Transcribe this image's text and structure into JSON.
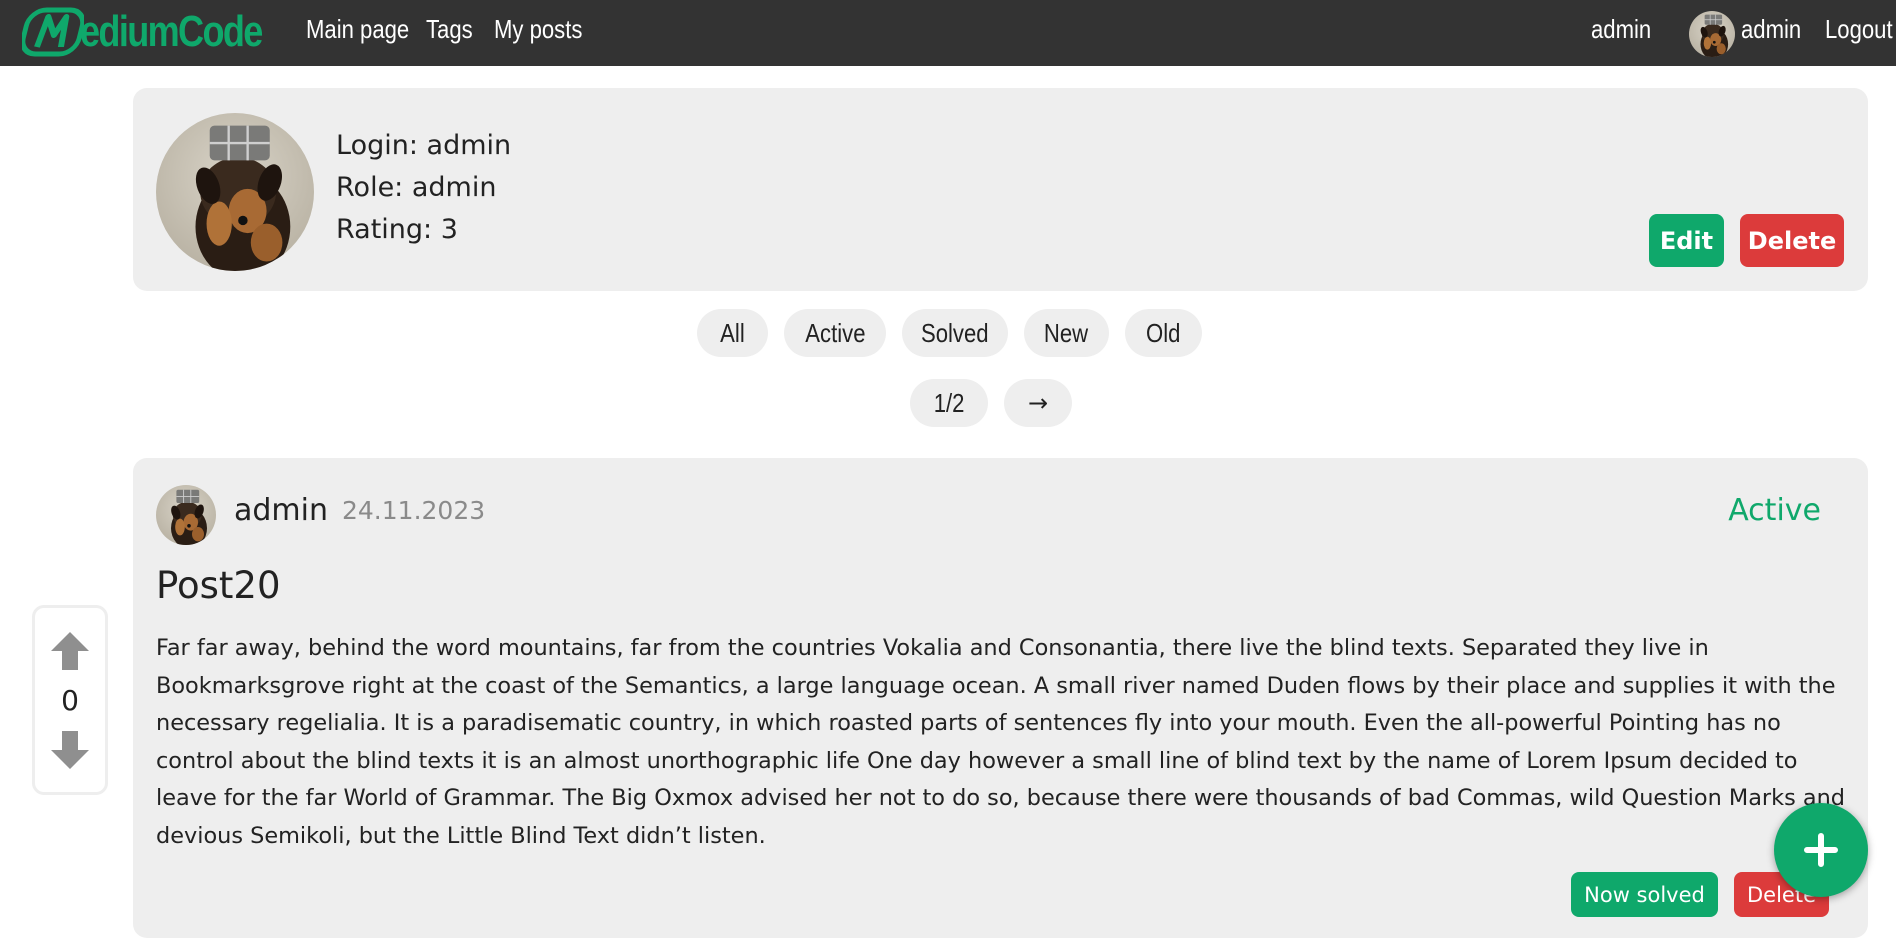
{
  "navbar": {
    "logo_text": "ediumCode",
    "links": [
      "Main page",
      "Tags",
      "My posts"
    ],
    "role_label": "admin",
    "user_name": "admin",
    "logout_label": "Logout"
  },
  "profile": {
    "login_line": "Login: admin",
    "role_line": "Role: admin",
    "rating_line": "Rating: 3",
    "edit_label": "Edit",
    "delete_label": "Delete"
  },
  "filters": [
    "All",
    "Active",
    "Solved",
    "New",
    "Old"
  ],
  "pagination": {
    "page": "1/2",
    "next": "→"
  },
  "post": {
    "author": "admin",
    "date": "24.11.2023",
    "status": "Active",
    "title": "Post20",
    "body": "Far far away, behind the word mountains, far from the countries Vokalia and Consonantia, there live the blind texts. Separated they live in Bookmarksgrove right at the coast of the Semantics, a large language ocean. A small river named Duden flows by their place and supplies it with the necessary regelialia. It is a paradisematic country, in which roasted parts of sentences fly into your mouth. Even the all-powerful Pointing has no control about the blind texts it is an almost unorthographic life One day however a small line of blind text by the name of Lorem Ipsum decided to leave for the far World of Grammar. The Big Oxmox advised her not to do so, because there were thousands of bad Commas, wild Question Marks and devious Semikoli, but the Little Blind Text didn’t listen.",
    "solve_label": "Now solved",
    "delete_label": "Delete"
  },
  "vote": {
    "count": "0"
  },
  "fab": {
    "icon": "plus-icon"
  },
  "colors": {
    "accent": "#0fa86b",
    "danger": "#dc3b3b",
    "navbar": "#333333",
    "card": "#eeeeee"
  }
}
